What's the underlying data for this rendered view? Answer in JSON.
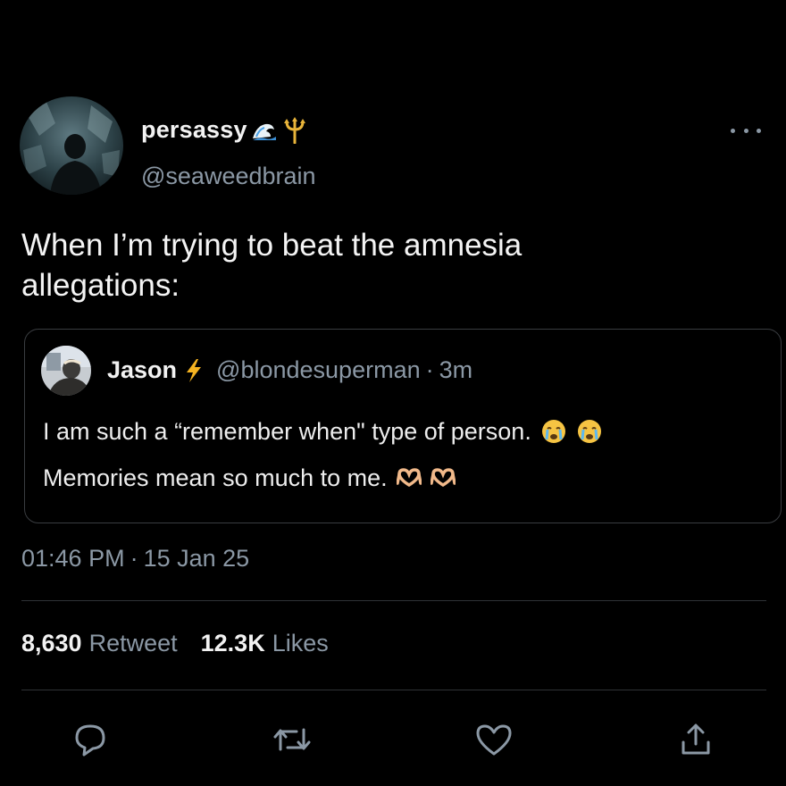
{
  "author": {
    "display_name": "persassy",
    "handle": "@seaweedbrain",
    "badge_icons": [
      "wave-emoji-icon",
      "trident-emoji-icon"
    ]
  },
  "tweet": {
    "text": "When I’m trying to beat the amnesia\nallegations:",
    "timestamp": "01:46 PM",
    "date_sep": "·",
    "date": "15 Jan 25"
  },
  "quote": {
    "display_name": "Jason",
    "name_icon": "lightning-emoji-icon",
    "handle": "@blondesuperman",
    "sep": "·",
    "time": "3m",
    "line1": "I am such a “remember when\" type of person.",
    "line2": "Memories mean so much to me.",
    "line1_emojis": [
      "crying-face-icon",
      "crying-face-icon"
    ],
    "line2_emojis": [
      "heart-hands-icon",
      "heart-hands-icon"
    ]
  },
  "stats": {
    "retweets_count": "8,630",
    "retweets_label": "Retweet",
    "likes_count": "12.3K",
    "likes_label": "Likes"
  },
  "actions": [
    "reply-icon",
    "retweet-icon",
    "like-icon",
    "share-icon"
  ],
  "colors": {
    "background": "#000000",
    "text_primary": "#e7e9ea",
    "text_secondary": "#8b98a5",
    "divider": "#2f3336",
    "lightning": "#f5b321",
    "trident": "#e8b43a"
  }
}
